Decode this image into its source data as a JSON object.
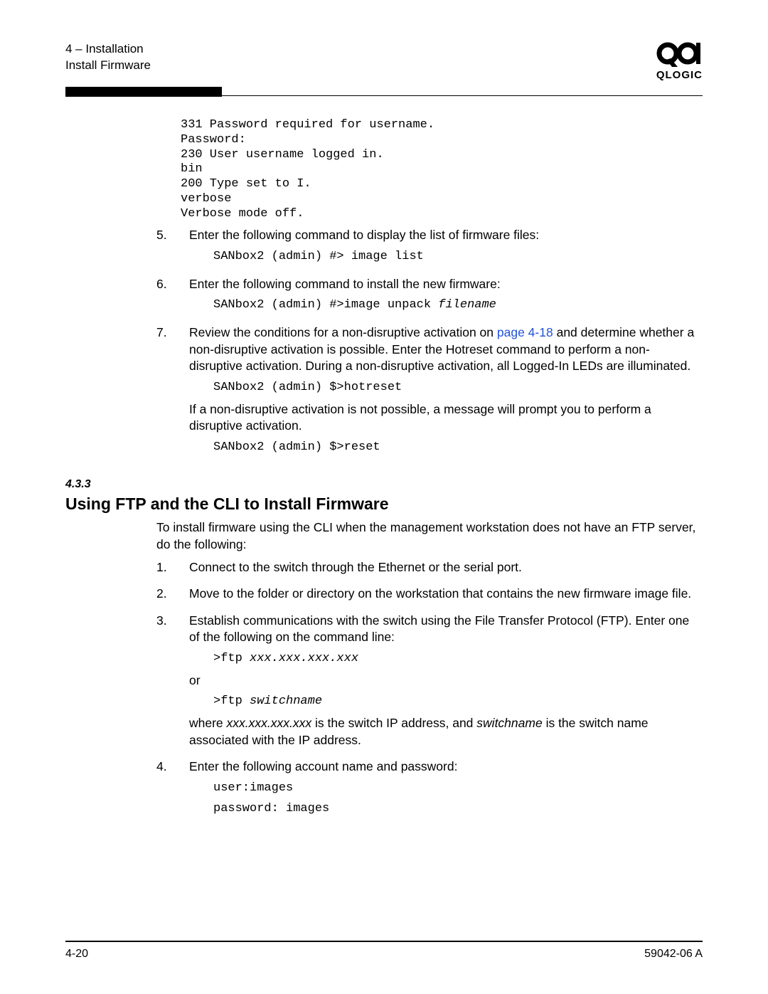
{
  "header": {
    "chapter_line": "4 – Installation",
    "section_line": "Install Firmware",
    "logo_text": "QLOGIC"
  },
  "code_block_top": "331 Password required for username.\nPassword:\n230 User username logged in.\nbin\n200 Type set to I.\nverbose\nVerbose mode off.",
  "steps_a": {
    "5": {
      "num": "5.",
      "text": "Enter the following command to display the list of firmware files:",
      "code": "SANbox2 (admin) #> image list"
    },
    "6": {
      "num": "6.",
      "text": "Enter the following command to install the new firmware:",
      "code_pre": "SANbox2 (admin) #>image unpack ",
      "code_ital": "filename"
    },
    "7": {
      "num": "7.",
      "text_before_link": "Review the conditions for a non-disruptive activation on ",
      "link_text": "page 4-18",
      "text_after_link": " and determine whether a non-disruptive activation is possible. Enter the Hotreset command to perform a non-disruptive activation. During a non-disruptive activation, all Logged-In LEDs are illuminated.",
      "code": "SANbox2 (admin) $>hotreset",
      "p2": "If a non-disruptive activation is not possible, a message will prompt you to perform a disruptive activation.",
      "code2": "SANbox2 (admin) $>reset"
    }
  },
  "section": {
    "num": "4.3.3",
    "title": "Using FTP and the CLI to Install Firmware",
    "intro": "To install firmware using the CLI when the management workstation does not have an FTP server, do the following:"
  },
  "steps_b": {
    "1": {
      "num": "1.",
      "text": "Connect to the switch through the Ethernet or the serial port."
    },
    "2": {
      "num": "2.",
      "text": "Move to the folder or directory on the workstation that contains the new firmware image file."
    },
    "3": {
      "num": "3.",
      "text": "Establish communications with the switch using the File Transfer Protocol (FTP). Enter one of the following on the command line:",
      "code1_pre": ">ftp ",
      "code1_ital": "xxx.xxx.xxx.xxx",
      "or": "or",
      "code2_pre": ">ftp ",
      "code2_ital": "switchname",
      "where_pre": "where ",
      "where_i1": "xxx.xxx.xxx.xxx",
      "where_mid": " is the switch IP address, and ",
      "where_i2": "switchname",
      "where_post": " is the switch name associated with the IP address."
    },
    "4": {
      "num": "4.",
      "text": "Enter the following account name and password:",
      "code1": "user:images",
      "code2": "password: images"
    }
  },
  "footer": {
    "left": "4-20",
    "right": "59042-06 A"
  }
}
